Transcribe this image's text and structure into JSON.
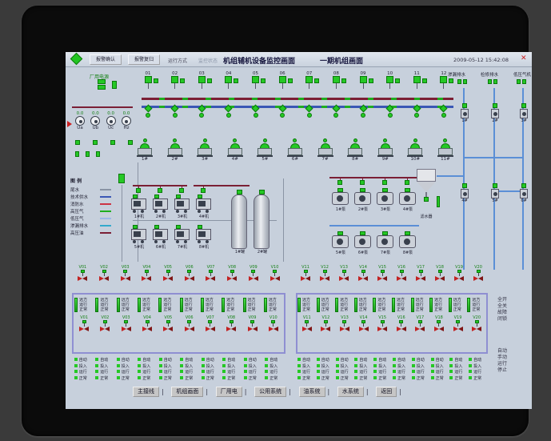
{
  "toolbar": {
    "btn1": "报警确认",
    "btn2": "报警复归",
    "info1": "运行方式",
    "info2": "监控状态",
    "title": "机组辅机设备监控画面",
    "subtitle": "一期机组画面",
    "datetime": "2009-05-12 15:42:08",
    "close": "✕"
  },
  "station": {
    "label": "厂用电源",
    "gauges": [
      {
        "value": "0.0",
        "label": "Ua"
      },
      {
        "value": "0.0",
        "label": "Ub"
      },
      {
        "value": "0.0",
        "label": "Uc"
      },
      {
        "value": "0.0",
        "label": "Hz"
      }
    ]
  },
  "bays": [
    "01",
    "02",
    "03",
    "04",
    "05",
    "06",
    "07",
    "08",
    "09",
    "10",
    "11",
    "12"
  ],
  "pumps": [
    "1#",
    "2#",
    "3#",
    "4#",
    "5#",
    "6#",
    "7#",
    "8#",
    "9#",
    "10#",
    "11#"
  ],
  "right_top": {
    "labels": [
      "渗漏排水",
      "检修排水",
      "低压气机"
    ]
  },
  "right_assemblies": [
    "1#",
    "2#",
    "3#",
    "4#",
    "5#",
    "6#"
  ],
  "legend": {
    "title": "图 例",
    "items": [
      {
        "label": "尾水",
        "color": "#8a94a4"
      },
      {
        "label": "技术供水",
        "color": "#3a57b5"
      },
      {
        "label": "消防水",
        "color": "#cc3344"
      },
      {
        "label": "高压气",
        "color": "#1fae1f"
      },
      {
        "label": "低压气",
        "color": "#9db8e8"
      },
      {
        "label": "渗漏排水",
        "color": "#33aacc"
      },
      {
        "label": "高压油",
        "color": "#7b1f35"
      }
    ]
  },
  "compressors": {
    "top": [
      "1#机",
      "2#机",
      "3#机",
      "4#机"
    ],
    "bottom": [
      "5#机",
      "6#机",
      "7#机",
      "8#机"
    ],
    "tanks": [
      "1#罐",
      "2#罐"
    ]
  },
  "drains": {
    "top": [
      "1#泵",
      "2#泵",
      "3#泵",
      "4#泵"
    ],
    "bottom": [
      "5#泵",
      "6#泵",
      "7#泵",
      "8#泵"
    ],
    "hopper": "滤水器"
  },
  "lower": {
    "left_valves": [
      "V01",
      "V02",
      "V03",
      "V04",
      "V05",
      "V06",
      "V07",
      "V08",
      "V09",
      "V10"
    ],
    "right_valves": [
      "V11",
      "V12",
      "V13",
      "V14",
      "V15",
      "V16",
      "V17",
      "V18",
      "V19",
      "V20"
    ],
    "led_lines": [
      "远方",
      "运行",
      "正常"
    ],
    "bottom_lines": [
      "自动",
      "投入",
      "运行",
      "正常"
    ],
    "side_group1": [
      "全开",
      "全关",
      "故障",
      "闭锁"
    ],
    "side_group2": [
      "自动",
      "手动",
      "运行",
      "停止"
    ]
  },
  "nav_buttons": [
    "主接线",
    "机组画面",
    "厂用电",
    "公用系统",
    "油系统",
    "水系统",
    "返回"
  ],
  "colors": {
    "bus1": "#7b1f35",
    "bus2": "#3a57b5",
    "pipe": "#5b8fd6",
    "device_green": "#25c825",
    "screen_bg": "#c7d0dc"
  }
}
